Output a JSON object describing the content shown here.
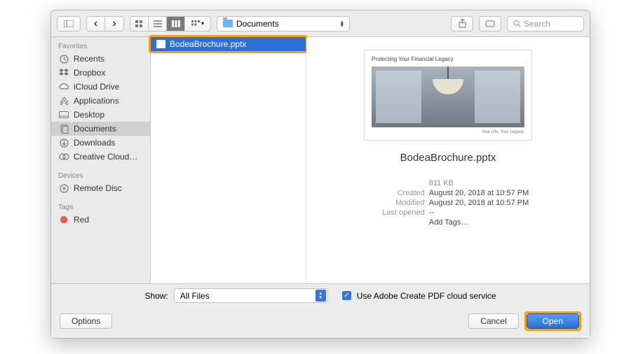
{
  "toolbar": {
    "location": "Documents",
    "search_placeholder": "Search"
  },
  "sidebar": {
    "sections": [
      {
        "header": "Favorites",
        "items": [
          {
            "label": "Recents",
            "icon": "clock"
          },
          {
            "label": "Dropbox",
            "icon": "dropbox"
          },
          {
            "label": "iCloud Drive",
            "icon": "cloud"
          },
          {
            "label": "Applications",
            "icon": "app"
          },
          {
            "label": "Desktop",
            "icon": "desktop"
          },
          {
            "label": "Documents",
            "icon": "doc",
            "selected": true
          },
          {
            "label": "Downloads",
            "icon": "download"
          },
          {
            "label": "Creative Cloud…",
            "icon": "cc"
          }
        ]
      },
      {
        "header": "Devices",
        "items": [
          {
            "label": "Remote Disc",
            "icon": "disc"
          }
        ]
      },
      {
        "header": "Tags",
        "items": [
          {
            "label": "Red",
            "icon": "tag-red"
          }
        ]
      }
    ]
  },
  "files": [
    {
      "name": "BodeaBrochure.pptx",
      "selected": true
    }
  ],
  "preview": {
    "slide_title": "Protecting Your Financial Legacy",
    "slide_footer": "Your Life. Your Legacy.",
    "filename": "BodeaBrochure.pptx",
    "size": "811 KB",
    "created_label": "Created",
    "created": "August 20, 2018 at 10:57 PM",
    "modified_label": "Modified",
    "modified": "August 20, 2018 at 10:57 PM",
    "lastopened_label": "Last opened",
    "lastopened": "--",
    "add_tags": "Add Tags…"
  },
  "bottom": {
    "show_label": "Show:",
    "show_value": "All Files",
    "cloud_label": "Use Adobe Create PDF cloud service",
    "options": "Options",
    "cancel": "Cancel",
    "open": "Open"
  }
}
